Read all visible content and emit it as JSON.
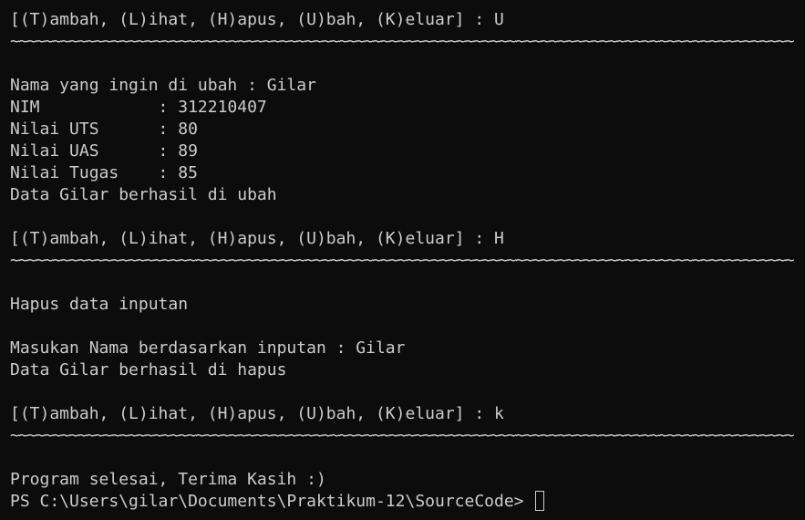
{
  "terminal": {
    "lines": [
      "[(T)ambah, (L)ihat, (H)apus, (U)bah, (K)eluar] : U",
      "~~~~~~~~~~~~~~~~~~~~~~~~~~~~~~~~~~~~~~~~~~~~~~~~~~~~~~~~~~~~~~~~~~~~~~~~~~~~~~~~~~~~~~~~~~~~~",
      "",
      "Nama yang ingin di ubah : Gilar",
      "NIM            : 312210407",
      "Nilai UTS      : 80",
      "Nilai UAS      : 89",
      "Nilai Tugas    : 85",
      "Data Gilar berhasil di ubah",
      "",
      "[(T)ambah, (L)ihat, (H)apus, (U)bah, (K)eluar] : H",
      "~~~~~~~~~~~~~~~~~~~~~~~~~~~~~~~~~~~~~~~~~~~~~~~~~~~~~~~~~~~~~~~~~~~~~~~~~~~~~~~~~~~~~~~~~~~~~",
      "",
      "Hapus data inputan",
      "",
      "Masukan Nama berdasarkan inputan : Gilar",
      "Data Gilar berhasil di hapus",
      "",
      "[(T)ambah, (L)ihat, (H)apus, (U)bah, (K)eluar] : k",
      "~~~~~~~~~~~~~~~~~~~~~~~~~~~~~~~~~~~~~~~~~~~~~~~~~~~~~~~~~~~~~~~~~~~~~~~~~~~~~~~~~~~~~~~~~~~~~",
      "",
      "Program selesai, Terima Kasih :)"
    ],
    "prompt": "PS C:\\Users\\gilar\\Documents\\Praktikum-12\\SourceCode> "
  }
}
